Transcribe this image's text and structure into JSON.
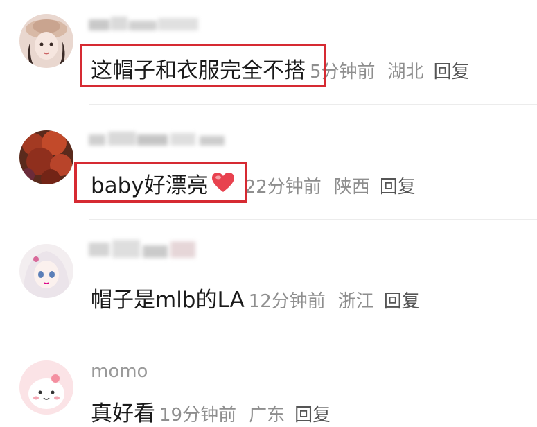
{
  "comments": [
    {
      "username": "",
      "text": "这帽子和衣服完全不搭",
      "time": "5分钟前",
      "location": "湖北",
      "reply_label": "回复",
      "highlighted": true
    },
    {
      "username": "",
      "text": "baby好漂亮",
      "emoji": "heart",
      "time": "22分钟前",
      "location": "陕西",
      "reply_label": "回复",
      "highlighted": true
    },
    {
      "username": "",
      "text": "帽子是mlb的LA",
      "time": "12分钟前",
      "location": "浙江",
      "reply_label": "回复",
      "highlighted": false
    },
    {
      "username": "momo",
      "text": "真好看",
      "time": "19分钟前",
      "location": "广东",
      "reply_label": "回复",
      "highlighted": false
    }
  ],
  "colors": {
    "highlight_border": "#d62a32",
    "meta_text": "#8e8e8e",
    "body_text": "#1a1a1a"
  }
}
